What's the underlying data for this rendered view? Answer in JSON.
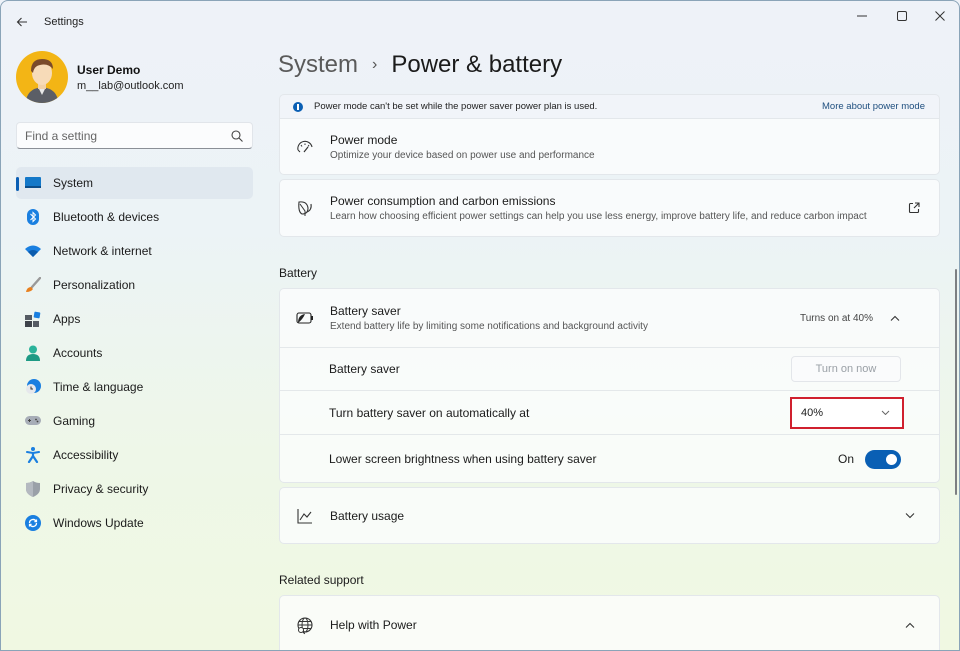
{
  "window": {
    "title": "Settings",
    "controls": {
      "minimize": "minimize",
      "maximize": "maximize",
      "close": "close"
    }
  },
  "user": {
    "name": "User Demo",
    "email": "m__lab@outlook.com"
  },
  "search": {
    "placeholder": "Find a setting",
    "value": ""
  },
  "sidebar": {
    "active": "System",
    "items": [
      {
        "label": "System",
        "icon": "monitor-icon"
      },
      {
        "label": "Bluetooth & devices",
        "icon": "bluetooth-icon"
      },
      {
        "label": "Network & internet",
        "icon": "wifi-icon"
      },
      {
        "label": "Personalization",
        "icon": "brush-icon"
      },
      {
        "label": "Apps",
        "icon": "apps-icon"
      },
      {
        "label": "Accounts",
        "icon": "person-icon"
      },
      {
        "label": "Time & language",
        "icon": "clock-globe-icon"
      },
      {
        "label": "Gaming",
        "icon": "gamepad-icon"
      },
      {
        "label": "Accessibility",
        "icon": "accessibility-icon"
      },
      {
        "label": "Privacy & security",
        "icon": "shield-icon"
      },
      {
        "label": "Windows Update",
        "icon": "update-icon"
      }
    ]
  },
  "breadcrumb": {
    "parent": "System",
    "separator": "›",
    "current": "Power & battery"
  },
  "info_bar": {
    "text": "Power mode can't be set while the power saver power plan is used.",
    "link": "More about power mode"
  },
  "power_mode": {
    "title": "Power mode",
    "subtitle": "Optimize your device based on power use and performance"
  },
  "power_consumption": {
    "title": "Power consumption and carbon emissions",
    "subtitle": "Learn how choosing efficient power settings can help you use less energy, improve battery life, and reduce carbon impact"
  },
  "battery_section": {
    "label": "Battery",
    "battery_saver": {
      "title": "Battery saver",
      "subtitle": "Extend battery life by limiting some notifications and background activity",
      "status": "Turns on at 40%",
      "expanded": true,
      "rows": {
        "saver_label": "Battery saver",
        "turn_on_now": "Turn on now",
        "auto_label": "Turn battery saver on automatically at",
        "auto_value": "40%",
        "brightness_label": "Lower screen brightness when using battery saver",
        "brightness_state": "On",
        "brightness_on": true
      }
    },
    "battery_usage": {
      "title": "Battery usage",
      "expanded": false
    }
  },
  "related_support": {
    "label": "Related support",
    "help": {
      "title": "Help with Power",
      "expanded": true
    }
  },
  "colors": {
    "accent": "#0a5fb4",
    "highlight_border": "#d0202e",
    "avatar_bg": "#f3b515"
  }
}
